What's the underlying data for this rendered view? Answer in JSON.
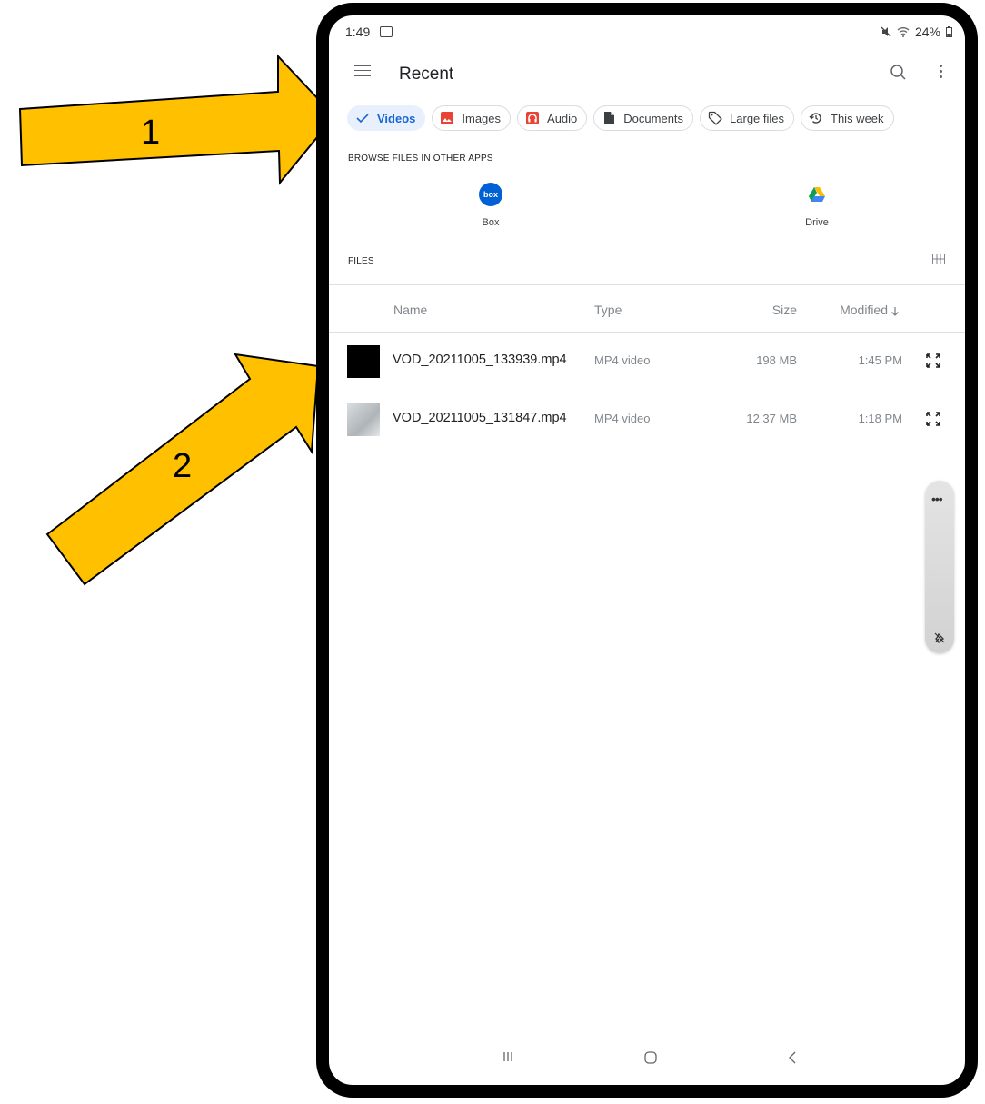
{
  "annotations": {
    "arrow1_label": "1",
    "arrow2_label": "2",
    "arrow_color": "#FFC000"
  },
  "status_bar": {
    "time": "1:49",
    "battery": "24%"
  },
  "toolbar": {
    "title": "Recent",
    "icons": [
      "menu-icon",
      "search-icon",
      "more-vert-icon"
    ]
  },
  "filter_chips": [
    {
      "label": "Videos",
      "icon": "check-icon",
      "selected": true
    },
    {
      "label": "Images",
      "icon": "image-icon",
      "selected": false
    },
    {
      "label": "Audio",
      "icon": "audio-icon",
      "selected": false
    },
    {
      "label": "Documents",
      "icon": "document-icon",
      "selected": false
    },
    {
      "label": "Large files",
      "icon": "tag-icon",
      "selected": false
    },
    {
      "label": "This week",
      "icon": "history-icon",
      "selected": false
    }
  ],
  "browse_section": {
    "label": "BROWSE FILES IN OTHER APPS",
    "apps": [
      {
        "name": "Box",
        "icon": "box-logo",
        "logo_text": "box"
      },
      {
        "name": "Drive",
        "icon": "google-drive-logo"
      }
    ]
  },
  "files_section": {
    "label": "FILES",
    "view_toggle_icon": "grid-view-icon",
    "columns": {
      "name": "Name",
      "type": "Type",
      "size": "Size",
      "modified": "Modified"
    },
    "rows": [
      {
        "name": "VOD_20211005_133939.mp4",
        "type": "MP4 video",
        "size": "198 MB",
        "modified": "1:45 PM",
        "thumbnail": "black-video-thumbnail"
      },
      {
        "name": "VOD_20211005_131847.mp4",
        "type": "MP4 video",
        "size": "12.37 MB",
        "modified": "1:18 PM",
        "thumbnail": "gray-video-thumbnail"
      }
    ]
  },
  "edge_panel": {
    "icons": [
      "more-horiz-icon",
      "pin-icon"
    ]
  },
  "colors": {
    "accent": "#1967d2",
    "selected_chip_bg": "#e8f0fe",
    "box_blue": "#0061d5",
    "image_red": "#ea4335"
  }
}
